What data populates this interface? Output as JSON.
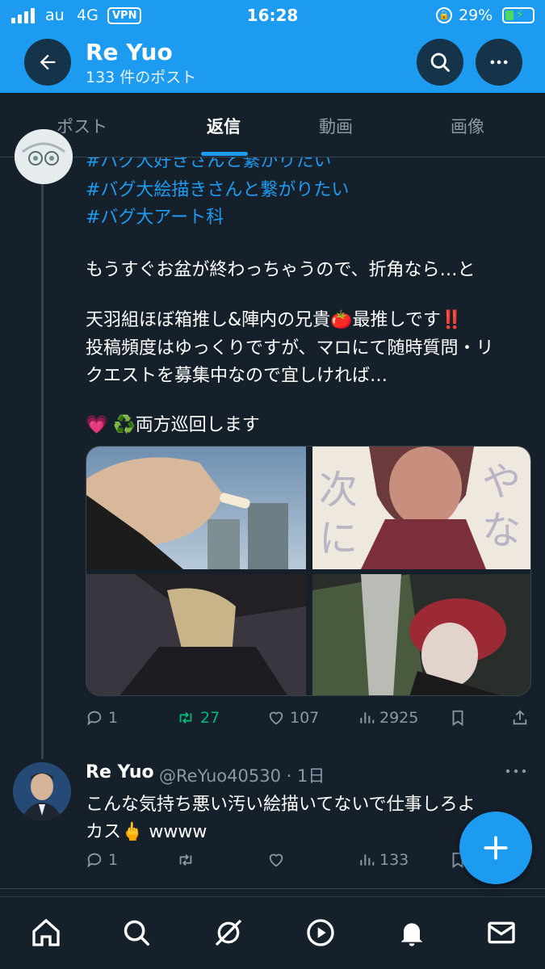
{
  "status": {
    "carrier": "au",
    "network": "4G",
    "vpn": "VPN",
    "time": "16:28",
    "battery_pct": "29%",
    "battery_level": 0.29,
    "battery_color": "#4cd964"
  },
  "header": {
    "title": "Re Yuo",
    "subtitle": "133 件のポスト",
    "accent": "#1d9bf0"
  },
  "tabs": [
    {
      "label": "ポスト"
    },
    {
      "label": "返信"
    },
    {
      "label": "動画"
    },
    {
      "label": "画像"
    }
  ],
  "post1": {
    "hashtags": [
      "#バグ大好きさんと繋がりたい",
      "#バグ大絵描きさんと繋がりたい",
      "#バグ大アート科"
    ],
    "line1": "もうすぐお盆が終わっちゃうので、折角なら…と",
    "line2": "天羽組ほぼ箱推し&陣内の兄貴🍅最推しです‼️",
    "line3": "投稿頻度はゆっくりですが、マロにて随時質問・リ",
    "line4": "クエストを募集中なので宜しければ…",
    "line5": "💗 ♻️両方巡回します",
    "stats": {
      "replies": "1",
      "retweets": "27",
      "likes": "107",
      "views": "2925"
    }
  },
  "reply": {
    "name": "Re Yuo",
    "handle_time": "@ReYuo40530 · 1日",
    "line1": "こんな気持ち悪い汚い絵描いてないで仕事しろよ",
    "line2": "カス🖕 wwww",
    "stats": {
      "replies": "1",
      "views": "133"
    }
  },
  "icons": {
    "back": "back-arrow-icon",
    "search": "search-icon",
    "more": "more-icon",
    "reply": "reply-icon",
    "retweet": "retweet-icon",
    "like": "heart-icon",
    "views": "views-icon",
    "bookmark": "bookmark-icon",
    "share": "share-icon",
    "compose": "plus-icon",
    "home": "home-icon",
    "explore": "search-icon",
    "grok": "grok-icon",
    "video": "play-icon",
    "notifications": "bell-icon",
    "messages": "mail-icon"
  }
}
